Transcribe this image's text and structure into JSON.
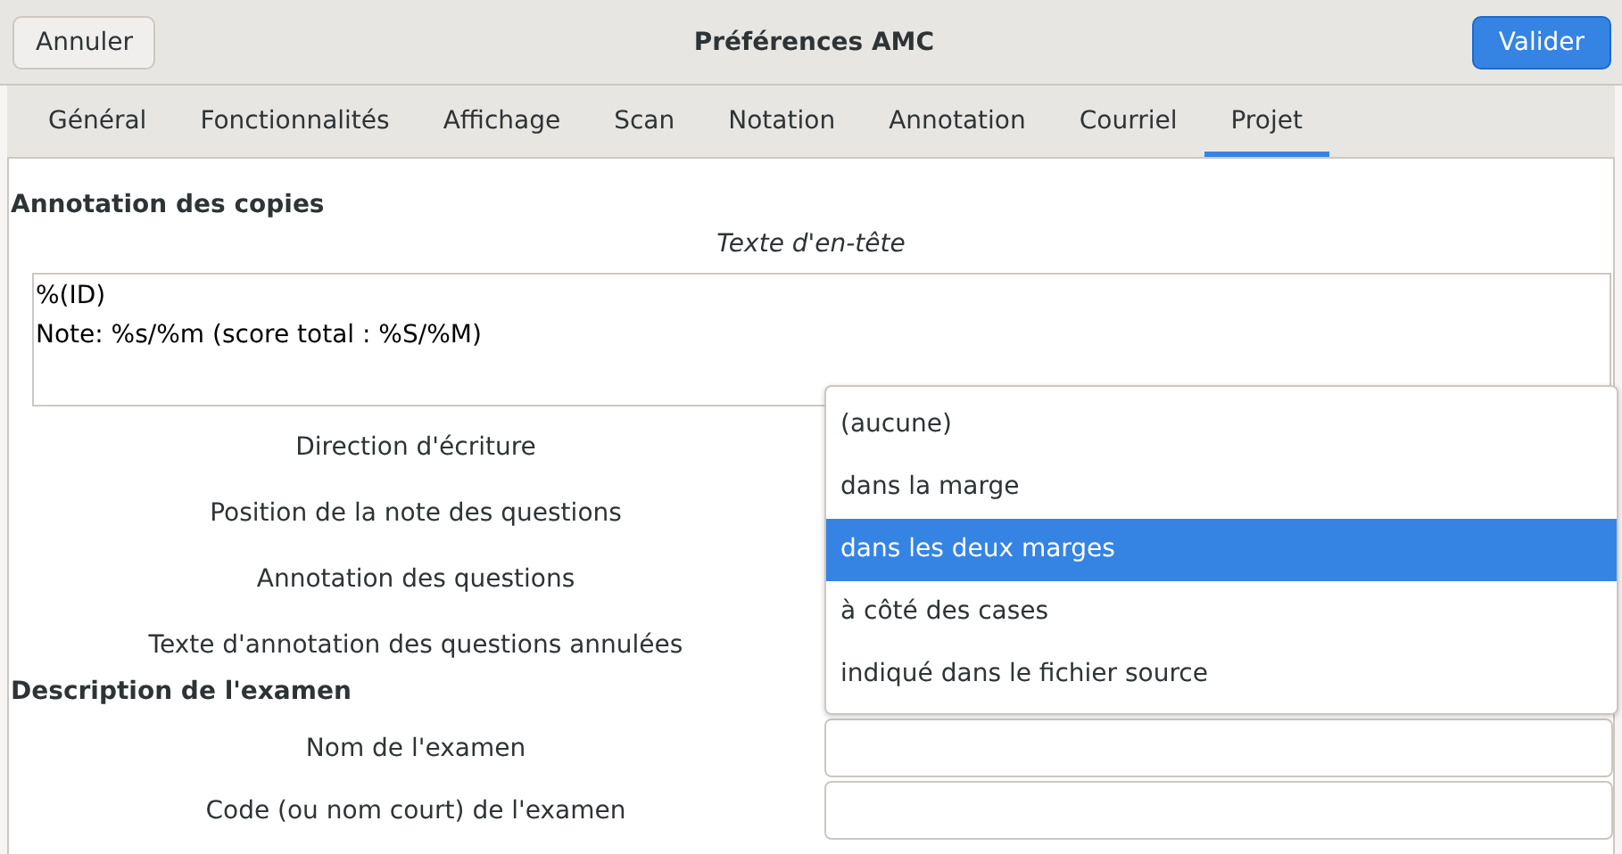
{
  "header": {
    "cancel_button": "Annuler",
    "title": "Préférences AMC",
    "confirm_button": "Valider"
  },
  "tabs": [
    {
      "label": "Général",
      "selected": false
    },
    {
      "label": "Fonctionnalités",
      "selected": false
    },
    {
      "label": "Affichage",
      "selected": false
    },
    {
      "label": "Scan",
      "selected": false
    },
    {
      "label": "Notation",
      "selected": false
    },
    {
      "label": "Annotation",
      "selected": false
    },
    {
      "label": "Courriel",
      "selected": false
    },
    {
      "label": "Projet",
      "selected": true
    }
  ],
  "annotation_section": {
    "title": "Annotation des copies",
    "header_text_label": "Texte d'en-tête",
    "header_text_lines": [
      "%(ID)",
      "Note: %s/%m (score total : %S/%M)"
    ],
    "rows": [
      {
        "label": "Direction d'écriture"
      },
      {
        "label": "Position de la note des questions",
        "open_menu": [
          {
            "label": "(aucune)",
            "selected": false
          },
          {
            "label": "dans la marge",
            "selected": false
          },
          {
            "label": "dans les deux marges",
            "selected": true
          },
          {
            "label": "à côté des cases",
            "selected": false
          },
          {
            "label": "indiqué dans le fichier source",
            "selected": false
          }
        ]
      },
      {
        "label": "Annotation des questions"
      },
      {
        "label": "Texte d'annotation des questions annulées"
      }
    ]
  },
  "description_section": {
    "title": "Description de l'examen",
    "fields": [
      {
        "label": "Nom de l'examen"
      },
      {
        "label": "Code (ou nom court) de l'examen"
      }
    ]
  }
}
